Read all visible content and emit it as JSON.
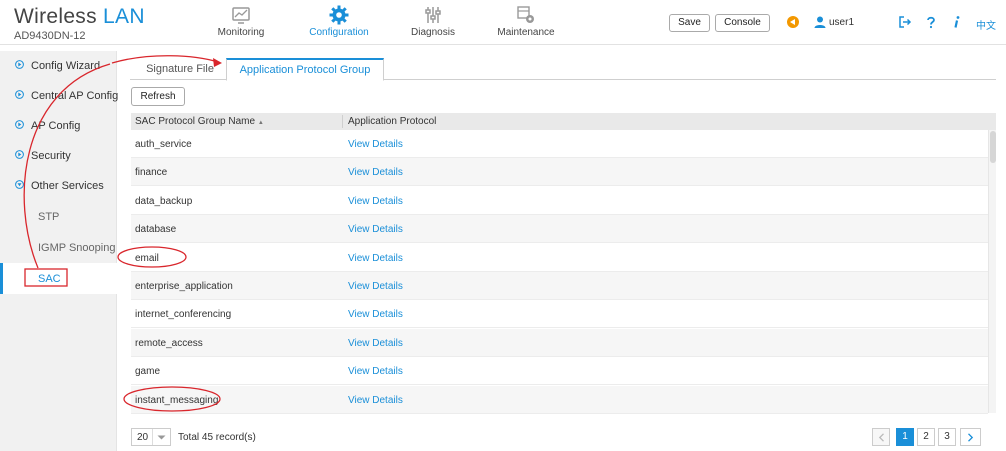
{
  "header": {
    "brand_word1": "Wireless",
    "brand_word2": "LAN",
    "model": "AD9430DN-12",
    "nav": [
      {
        "label": "Monitoring",
        "icon": "monitor-icon"
      },
      {
        "label": "Configuration",
        "icon": "gear-icon"
      },
      {
        "label": "Diagnosis",
        "icon": "sliders-icon"
      },
      {
        "label": "Maintenance",
        "icon": "maintenance-icon"
      }
    ],
    "active_nav": "Configuration",
    "save_label": "Save",
    "console_label": "Console",
    "user": "user1",
    "lang": "中文",
    "colors": {
      "accent": "#1a8fd8",
      "alert": "#f39800"
    }
  },
  "sidebar": {
    "items": [
      {
        "label": "Config Wizard",
        "icon": "expand-circle-icon"
      },
      {
        "label": "Central AP Config",
        "icon": "expand-circle-icon"
      },
      {
        "label": "AP Config",
        "icon": "expand-circle-icon"
      },
      {
        "label": "Security",
        "icon": "expand-circle-icon"
      },
      {
        "label": "Other Services",
        "icon": "collapse-circle-icon"
      }
    ],
    "subitems": [
      {
        "label": "STP"
      },
      {
        "label": "IGMP Snooping"
      },
      {
        "label": "SAC",
        "selected": true
      }
    ]
  },
  "tabs": [
    {
      "label": "Signature File"
    },
    {
      "label": "Application Protocol Group",
      "active": true
    }
  ],
  "refresh_label": "Refresh",
  "table": {
    "columns": [
      "SAC Protocol Group Name",
      "Application Protocol"
    ],
    "sort_indicator": "▲",
    "rows": [
      {
        "name": "auth_service",
        "link": "View Details"
      },
      {
        "name": "finance",
        "link": "View Details"
      },
      {
        "name": "data_backup",
        "link": "View Details"
      },
      {
        "name": "database",
        "link": "View Details"
      },
      {
        "name": "email",
        "link": "View Details"
      },
      {
        "name": "enterprise_application",
        "link": "View Details"
      },
      {
        "name": "internet_conferencing",
        "link": "View Details"
      },
      {
        "name": "remote_access",
        "link": "View Details"
      },
      {
        "name": "game",
        "link": "View Details"
      },
      {
        "name": "instant_messaging",
        "link": "View Details"
      }
    ]
  },
  "pagination": {
    "page_size": "20",
    "total": "Total 45 record(s)",
    "pages": [
      "1",
      "2",
      "3"
    ],
    "current": "1"
  }
}
